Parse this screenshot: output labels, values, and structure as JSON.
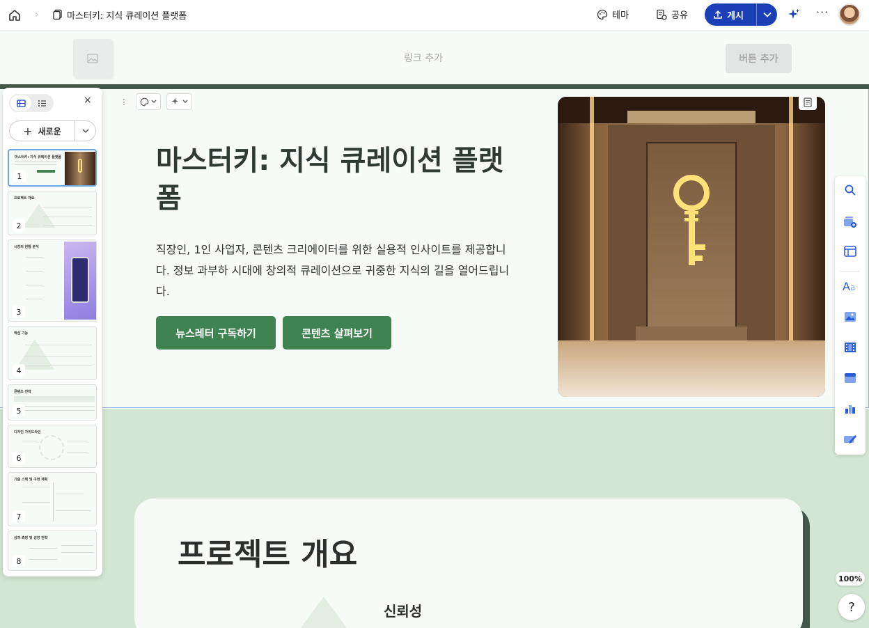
{
  "topbar": {
    "title": "마스터키: 지식 큐레이션 플랫폼",
    "theme_label": "테마",
    "share_label": "공유",
    "publish_label": "게시",
    "more_label": "···"
  },
  "nav": {
    "link_add": "링크 추가",
    "button_add": "버튼 추가"
  },
  "hero": {
    "title": "마스터키: 지식 큐레이션 플랫폼",
    "description": "직장인, 1인 사업자, 콘텐츠 크리에이터를 위한 실용적 인사이트를 제공합니다. 정보 과부하 시대에 창의적 큐레이션으로 귀중한 지식의 길을 열어드립니다.",
    "cta_primary": "뉴스레터 구독하기",
    "cta_secondary": "콘텐츠 살펴보기"
  },
  "overview": {
    "title": "프로젝트 개요",
    "item1": "신뢰성"
  },
  "left_panel": {
    "new_label": "새로운",
    "close_label": "×",
    "slides": [
      {
        "num": "1",
        "title": "마스터키: 지식 큐레이션 플랫폼"
      },
      {
        "num": "2",
        "title": "프로젝트 개요"
      },
      {
        "num": "3",
        "title": "시장의 현황 분석"
      },
      {
        "num": "4",
        "title": "핵심 기능"
      },
      {
        "num": "5",
        "title": "콘텐츠 전략"
      },
      {
        "num": "6",
        "title": "디자인 가이드라인"
      },
      {
        "num": "7",
        "title": "기술 스택 및 구현 계획"
      },
      {
        "num": "8",
        "title": "성과 측정 및 성장 전략"
      }
    ]
  },
  "zoom": "100%",
  "help": "?",
  "colors": {
    "primary_green": "#3f8450",
    "dark_green": "#44584a",
    "light_bg": "#f6fbf7",
    "mint_bg": "#d2e6d3",
    "publish_blue": "#1a3fb6"
  }
}
